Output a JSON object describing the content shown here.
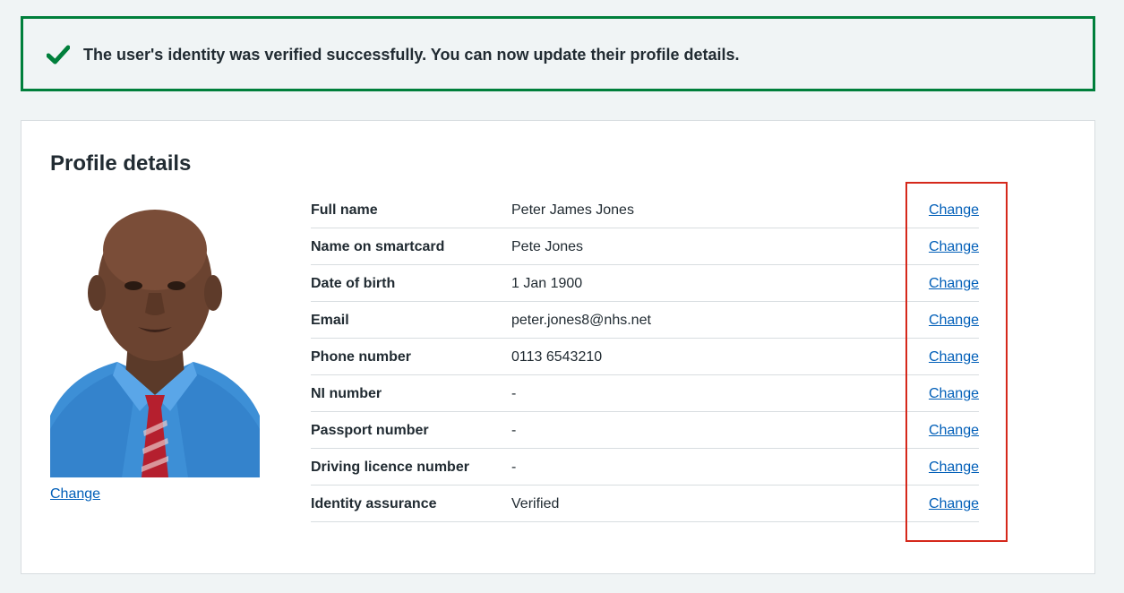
{
  "banner": {
    "message": "The user's identity was verified successfully. You can now update their profile details.",
    "icon": "tick-icon",
    "color": "#007f3b"
  },
  "profile": {
    "title": "Profile details",
    "photo_change_label": "Change",
    "rows": [
      {
        "key": "Full name",
        "value": "Peter James Jones",
        "action": "Change"
      },
      {
        "key": "Name on smartcard",
        "value": "Pete Jones",
        "action": "Change"
      },
      {
        "key": "Date of birth",
        "value": "1 Jan 1900",
        "action": "Change"
      },
      {
        "key": "Email",
        "value": "peter.jones8@nhs.net",
        "action": "Change"
      },
      {
        "key": "Phone number",
        "value": "0113 6543210",
        "action": "Change"
      },
      {
        "key": "NI number",
        "value": "-",
        "action": "Change"
      },
      {
        "key": "Passport number",
        "value": "-",
        "action": "Change"
      },
      {
        "key": "Driving licence number",
        "value": "-",
        "action": "Change"
      },
      {
        "key": "Identity assurance",
        "value": "Verified",
        "action": "Change"
      }
    ]
  },
  "colors": {
    "link": "#005eb8",
    "success": "#007f3b",
    "highlight": "#d5281b",
    "background": "#f0f4f5"
  }
}
